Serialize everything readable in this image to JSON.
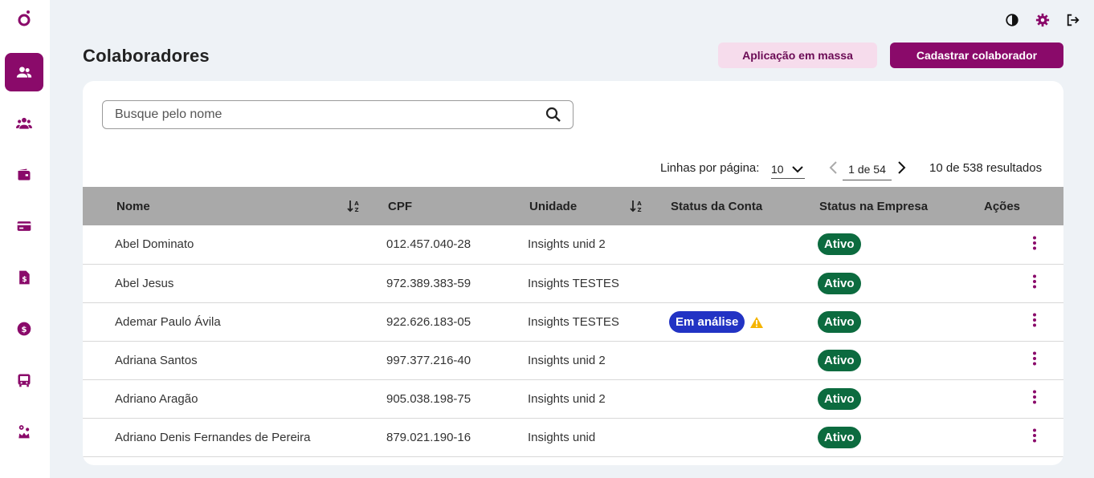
{
  "app": {
    "accent": "#8a0a6a",
    "nav": [
      {
        "icon": "users-icon",
        "active": true
      },
      {
        "icon": "group-icon",
        "active": false
      },
      {
        "icon": "wallet-icon",
        "active": false
      },
      {
        "icon": "card-icon",
        "active": false
      },
      {
        "icon": "invoice-icon",
        "active": false
      },
      {
        "icon": "dollar-icon",
        "active": false
      },
      {
        "icon": "transport-icon",
        "active": false
      },
      {
        "icon": "settings-crown-icon",
        "active": false
      }
    ]
  },
  "header": {
    "title": "Colaboradores",
    "bulk_button": "Aplicação em massa",
    "register_button": "Cadastrar colaborador"
  },
  "search": {
    "placeholder": "Busque pelo nome"
  },
  "pagination": {
    "rows_label": "Linhas por página:",
    "rows_value": "10",
    "page_indicator": "1 de 54",
    "results": "10 de 538 resultados"
  },
  "table": {
    "headers": {
      "name": "Nome",
      "cpf": "CPF",
      "unit": "Unidade",
      "account_status": "Status da Conta",
      "company_status": "Status na Empresa",
      "actions": "Ações"
    },
    "rows": [
      {
        "name": "Abel Dominato",
        "cpf": "012.457.040-28",
        "unit": "Insights unid 2",
        "account_status": "",
        "company_status": "Ativo"
      },
      {
        "name": "Abel Jesus",
        "cpf": "972.389.383-59",
        "unit": "Insights TESTES",
        "account_status": "",
        "company_status": "Ativo"
      },
      {
        "name": "Ademar Paulo Ávila",
        "cpf": "922.626.183-05",
        "unit": "Insights TESTES",
        "account_status": "Em análise",
        "company_status": "Ativo"
      },
      {
        "name": "Adriana Santos",
        "cpf": "997.377.216-40",
        "unit": "Insights unid 2",
        "account_status": "",
        "company_status": "Ativo"
      },
      {
        "name": "Adriano Aragão",
        "cpf": "905.038.198-75",
        "unit": "Insights unid 2",
        "account_status": "",
        "company_status": "Ativo"
      },
      {
        "name": "Adriano Denis Fernandes de Pereira",
        "cpf": "879.021.190-16",
        "unit": "Insights unid",
        "account_status": "",
        "company_status": "Ativo"
      }
    ]
  }
}
